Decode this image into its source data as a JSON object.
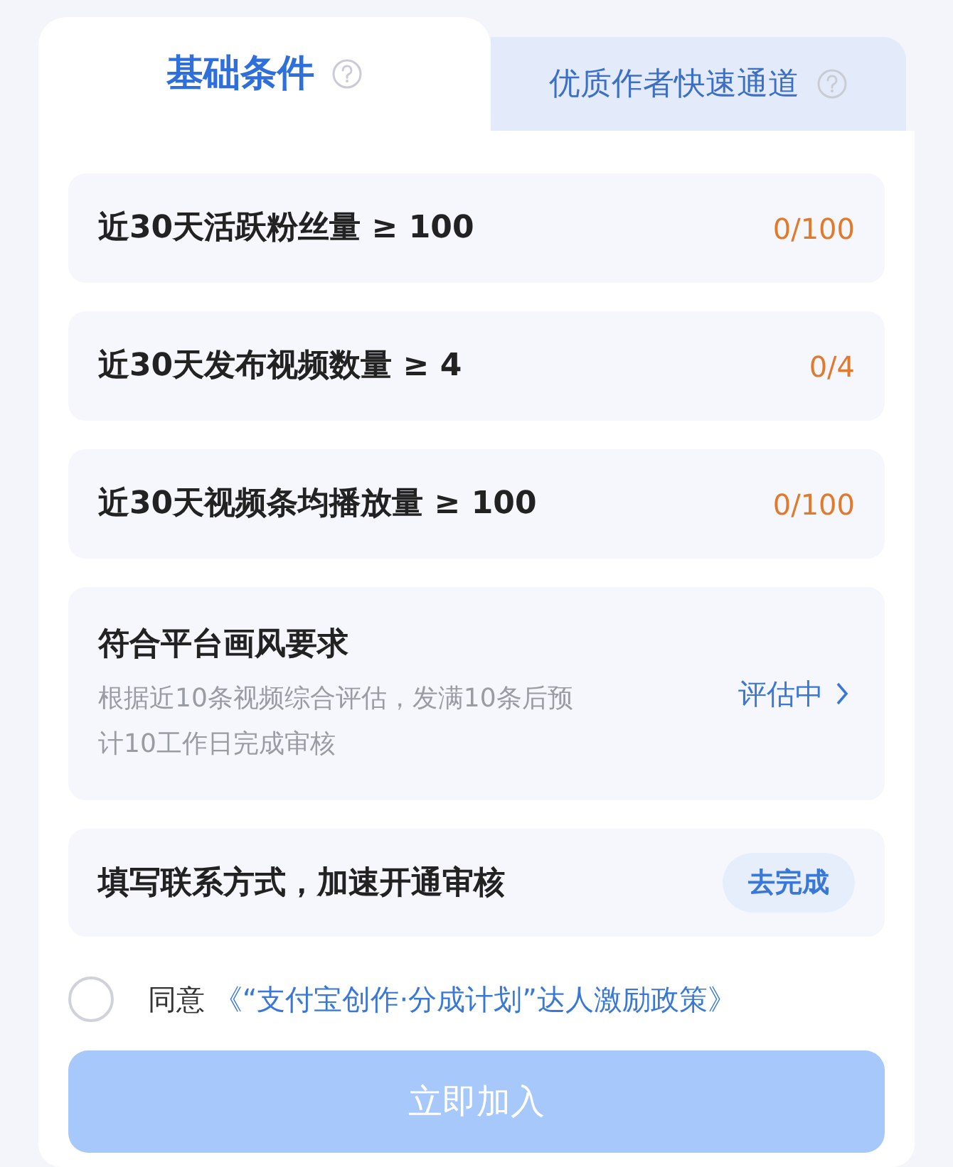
{
  "tabs": [
    {
      "label": "基础条件",
      "selected": true,
      "help": true
    },
    {
      "label": "优质作者快速通道",
      "selected": false,
      "help": true
    }
  ],
  "conditions": [
    {
      "kind": "progress",
      "label": "近30天活跃粉丝量 ≥ 100",
      "count": "0/100"
    },
    {
      "kind": "progress",
      "label": "近30天发布视频数量 ≥ 4",
      "count": "0/4"
    },
    {
      "kind": "progress",
      "label": "近30天视频条均播放量 ≥ 100",
      "count": "0/100"
    },
    {
      "kind": "evaluation",
      "label": "符合平台画风要求",
      "description": "根据近10条视频综合评估，发满10条后预计10工作日完成审核",
      "status": "评估中"
    },
    {
      "kind": "action",
      "label": "填写联系方式，加速开通审核",
      "action": "去完成"
    }
  ],
  "agreement": {
    "checked": false,
    "prefix": "同意",
    "link": "《“支付宝创作·分成计划”达人激励政策》"
  },
  "submit": {
    "label": "立即加入",
    "disabled": true
  }
}
